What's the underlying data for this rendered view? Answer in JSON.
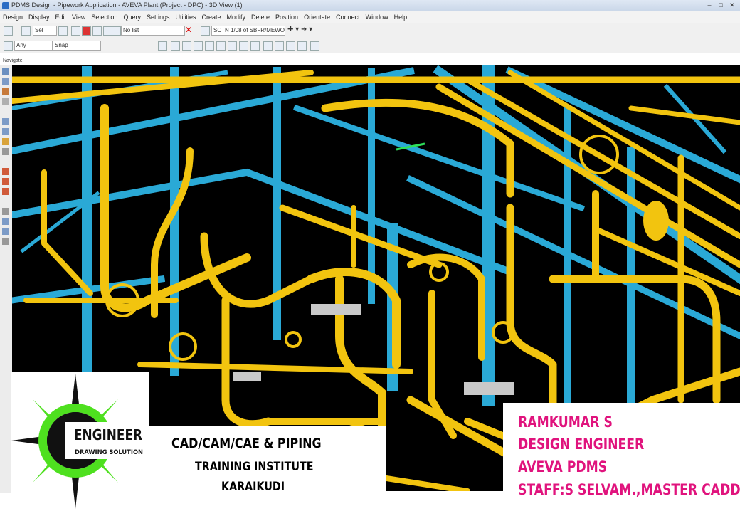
{
  "window": {
    "title": "PDMS Design - Pipework Application - AVEVA Plant (Project - DPC) - 3D View (1)"
  },
  "menu": [
    "Design",
    "Display",
    "Edit",
    "View",
    "Selection",
    "Query",
    "Settings",
    "Utilities",
    "Create",
    "Modify",
    "Delete",
    "Position",
    "Orientate",
    "Connect",
    "Window",
    "Help"
  ],
  "toolbar1": {
    "undo_field": "Sel",
    "list_field": "No list",
    "element_field": "SCTN 1/08 of SBFR/MEWON"
  },
  "toolbar2": {
    "filter_field": "Any",
    "snap_field": "Snap"
  },
  "panel_label": "Navigate",
  "logo": {
    "name": "ENGINEER",
    "tagline": "DRAWING SOLUTION"
  },
  "institute": {
    "line1": "CAD/CAM/CAE  & PIPING",
    "line2": "TRAINING INSTITUTE",
    "line3": "KARAIKUDI"
  },
  "staff": {
    "line1": "RAMKUMAR S",
    "line2": "DESIGN ENGINEER",
    "line3": "AVEVA PDMS",
    "line4": "STAFF:S SELVAM.,MASTER CADD"
  },
  "colors": {
    "pipe": "#f2c40f",
    "steel": "#2aa9d6",
    "background": "#000000",
    "accent_text": "#e0137d",
    "logo_green": "#4ee01f"
  }
}
